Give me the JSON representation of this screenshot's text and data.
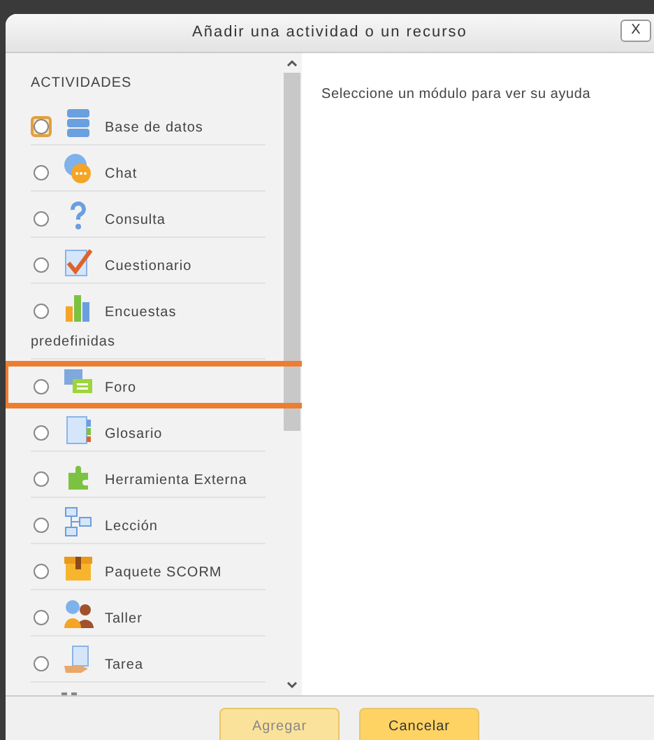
{
  "dialog": {
    "title": "Añadir una actividad o un recurso",
    "close_label": "X"
  },
  "section_heading": "ACTIVIDADES",
  "items": [
    {
      "kind": "database",
      "label": "Base de datos",
      "selected": false,
      "focused": true,
      "highlighted": false
    },
    {
      "kind": "chat",
      "label": "Chat",
      "selected": false,
      "focused": false,
      "highlighted": false
    },
    {
      "kind": "question",
      "label": "Consulta",
      "selected": false,
      "focused": false,
      "highlighted": false
    },
    {
      "kind": "quiz",
      "label": "Cuestionario",
      "selected": false,
      "focused": false,
      "highlighted": false
    },
    {
      "kind": "chart",
      "label": "Encuestas",
      "label_continued": "predefinidas",
      "selected": false,
      "focused": false,
      "highlighted": false
    },
    {
      "kind": "forum",
      "label": "Foro",
      "selected": false,
      "focused": false,
      "highlighted": true
    },
    {
      "kind": "glossary",
      "label": "Glosario",
      "selected": false,
      "focused": false,
      "highlighted": false
    },
    {
      "kind": "puzzle",
      "label": "Herramienta Externa",
      "selected": false,
      "focused": false,
      "highlighted": false
    },
    {
      "kind": "lesson",
      "label": "Lección",
      "selected": false,
      "focused": false,
      "highlighted": false
    },
    {
      "kind": "package",
      "label": "Paquete SCORM",
      "selected": false,
      "focused": false,
      "highlighted": false
    },
    {
      "kind": "workshop",
      "label": "Taller",
      "selected": false,
      "focused": false,
      "highlighted": false
    },
    {
      "kind": "assignment",
      "label": "Tarea",
      "selected": false,
      "focused": false,
      "highlighted": false
    }
  ],
  "help_text": "Seleccione un módulo para ver su ayuda",
  "buttons": [
    {
      "label": "Agregar",
      "disabled": true
    },
    {
      "label": "Cancelar",
      "disabled": false
    }
  ]
}
